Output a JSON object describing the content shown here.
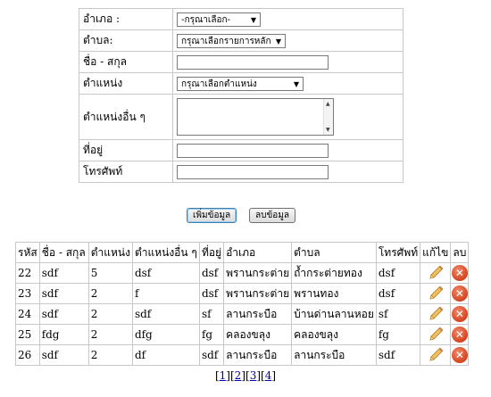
{
  "form": {
    "amphoe_label": "อำเภอ :",
    "amphoe_value": "-กรุณาเลือก-",
    "tambon_label": "ตำบล:",
    "tambon_value": "กรุณาเลือกรายการหลัก",
    "name_label": "ชื่อ - สกุล",
    "position_label": "ตำแหน่ง",
    "position_value": "กรุณาเลือกตำแหน่ง",
    "other_position_label": "ตำแหน่งอื่น ๆ",
    "address_label": "ที่อยู่",
    "phone_label": "โทรศัพท์"
  },
  "buttons": {
    "add_label": "เพิ่มข้อมูล",
    "delete_label": "ลบข้อมูล"
  },
  "table": {
    "headers": [
      "รหัส",
      "ชื่อ - สกุล",
      "ตำแหน่ง",
      "ตำแหน่งอื่น ๆ",
      "ที่อยู่",
      "อำเภอ",
      "ตำบล",
      "โทรศัพท์",
      "แก้ไข",
      "ลบ"
    ],
    "rows": [
      {
        "id": "22",
        "name": "sdf",
        "position": "5",
        "other": "dsf",
        "address": "dsf",
        "amphoe": "พรานกระต่าย",
        "tambon": "ถ้ำกระต่ายทอง",
        "phone": "dsf"
      },
      {
        "id": "23",
        "name": "sdf",
        "position": "2",
        "other": "f",
        "address": "dsf",
        "amphoe": "พรานกระต่าย",
        "tambon": "พรานทอง",
        "phone": "dsf"
      },
      {
        "id": "24",
        "name": "sdf",
        "position": "2",
        "other": "sdf",
        "address": "sf",
        "amphoe": "ลานกระบือ",
        "tambon": "บ้านด่านลานหอย",
        "phone": "sf"
      },
      {
        "id": "25",
        "name": "fdg",
        "position": "2",
        "other": "dfg",
        "address": "fg",
        "amphoe": "คลองขลุง",
        "tambon": "คลองขลุง",
        "phone": "fg"
      },
      {
        "id": "26",
        "name": "sdf",
        "position": "2",
        "other": "df",
        "address": "sdf",
        "amphoe": "ลานกระบือ",
        "tambon": "ลานกระบือ",
        "phone": "sdf"
      }
    ]
  },
  "pager": {
    "pages": [
      "1",
      "2",
      "3",
      "4"
    ]
  },
  "icons": {
    "edit": "pencil-icon",
    "delete": "delete-icon"
  },
  "colors": {
    "delete_icon": "#d4431f",
    "pencil": "#e8b04a",
    "link": "#0000aa"
  }
}
